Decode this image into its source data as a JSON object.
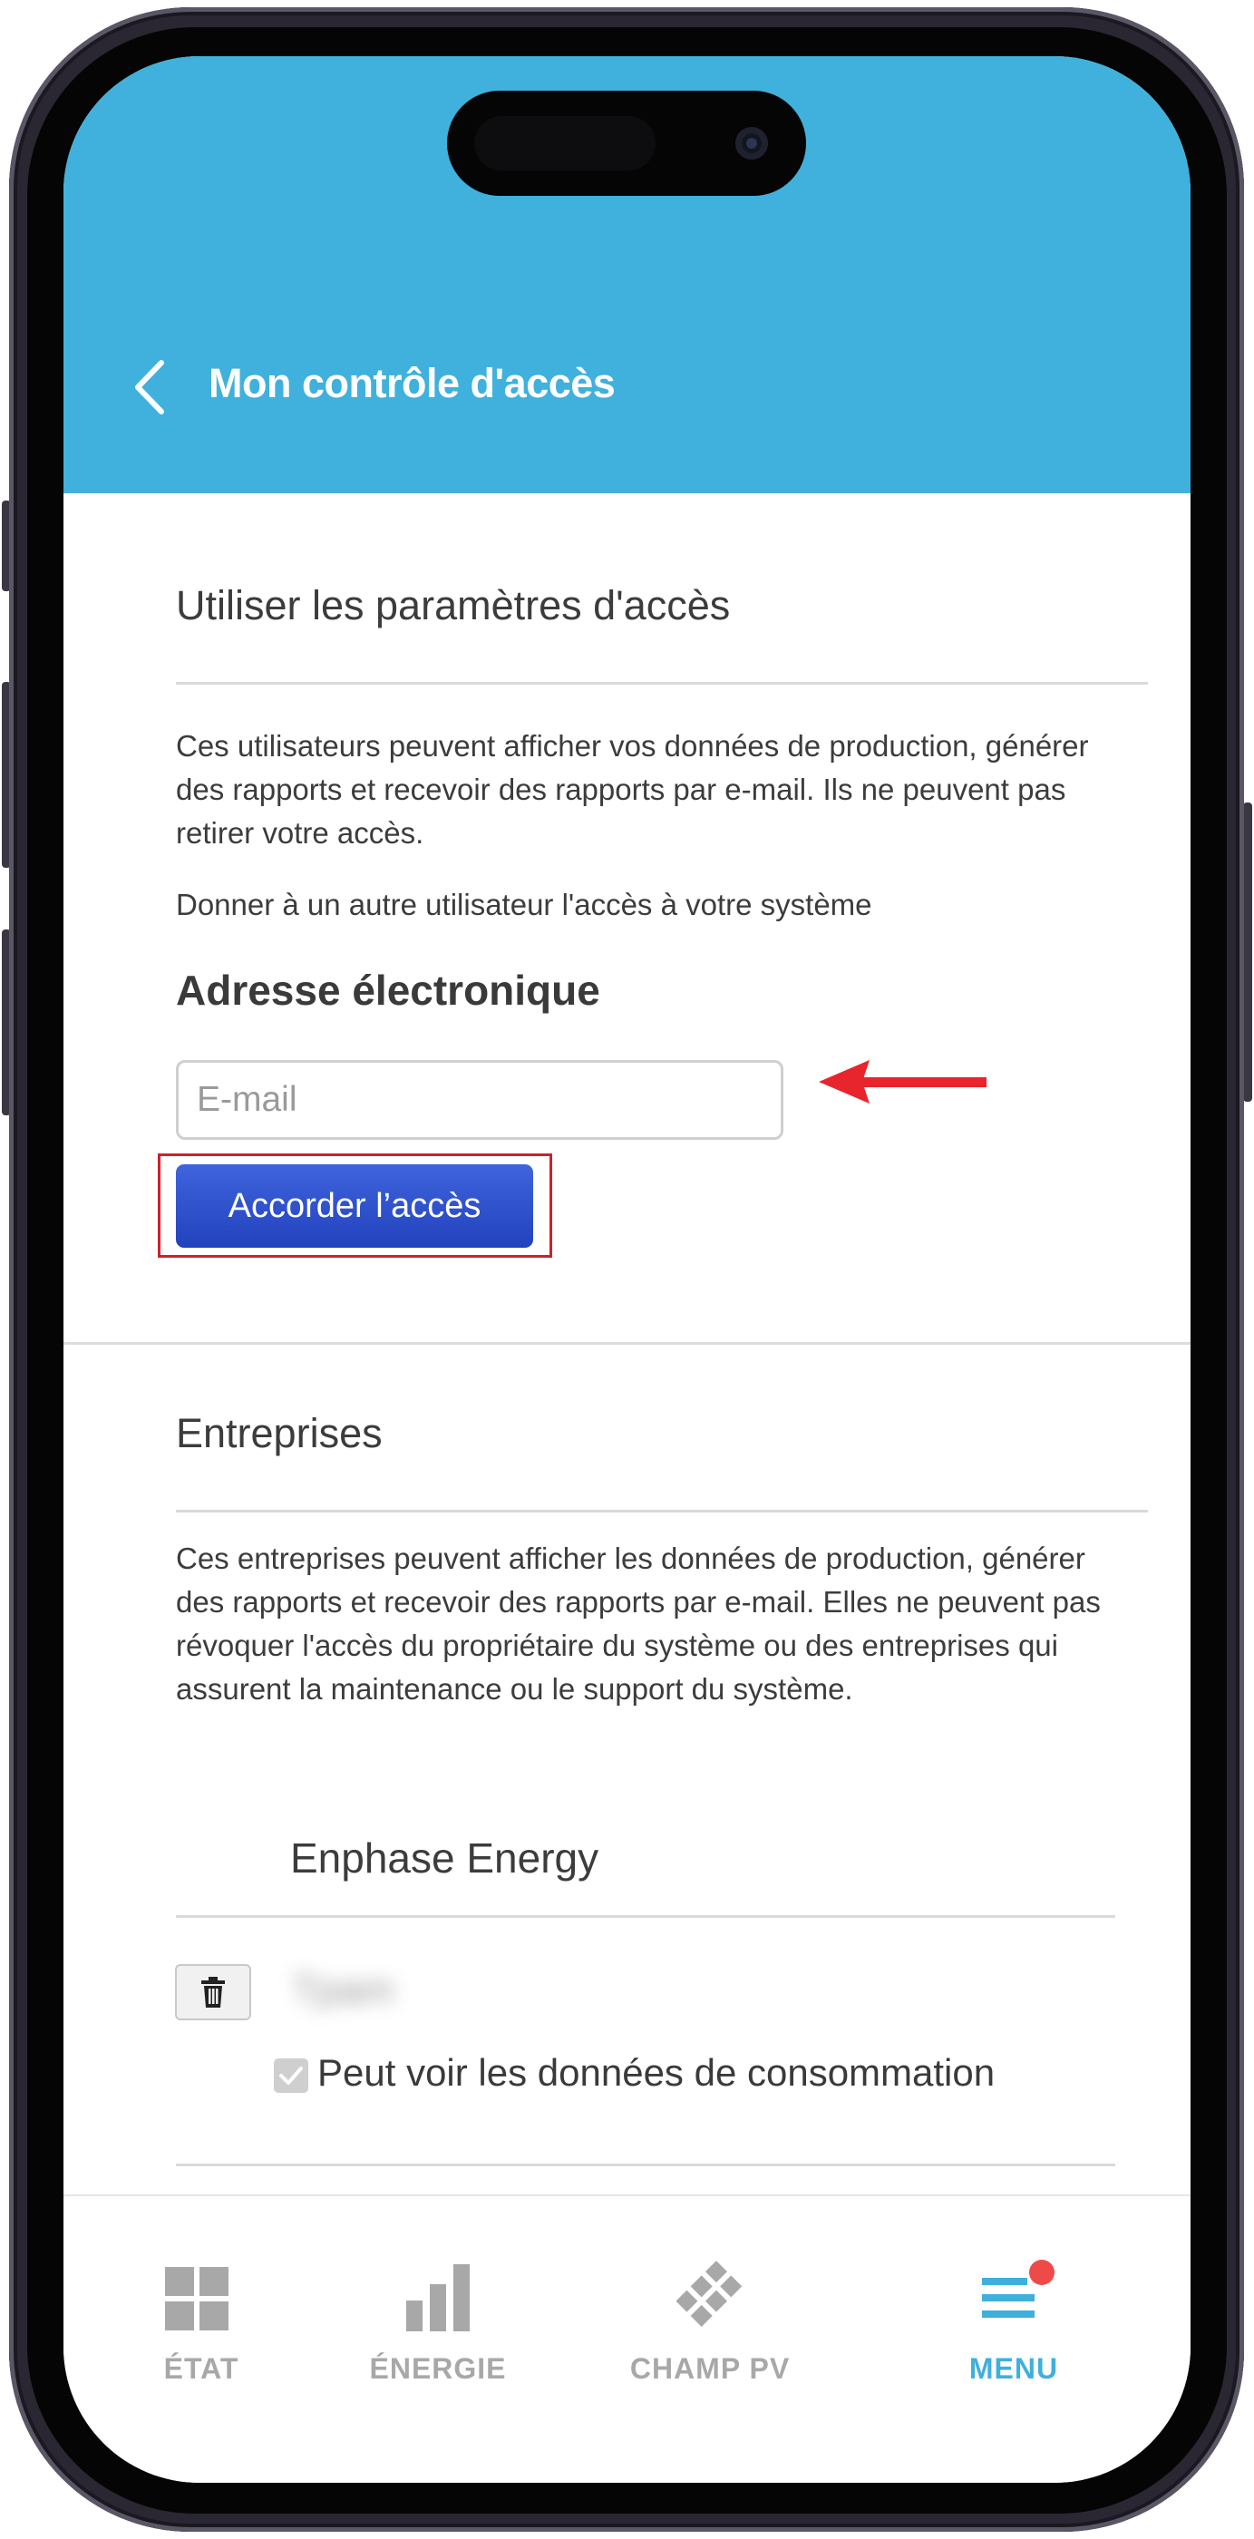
{
  "header": {
    "title": "Mon contrôle d'accès"
  },
  "user_access": {
    "section_title": "Utiliser les paramètres d'accès",
    "description": "Ces utilisateurs peuvent afficher vos données de production, générer des rapports et recevoir des rapports par e-mail. Ils ne peuvent pas retirer votre accès.",
    "give_access_text": "Donner à un autre utilisateur l'accès à votre système",
    "email_label": "Adresse électronique",
    "email_placeholder": "E-mail",
    "email_value": "",
    "grant_button_label": "Accorder l’accès"
  },
  "companies": {
    "section_title": "Entreprises",
    "description": "Ces entreprises peuvent afficher les données de production, générer des rapports et recevoir des rapports par e-mail. Elles ne peuvent pas révoquer l'accès du propriétaire du système ou des entreprises qui assurent la maintenance ou le support du système.",
    "company_name": "Enphase Energy",
    "member_name_blurred": "Tpam",
    "consumption_permission_label": "Peut voir les données de consommation",
    "consumption_permission_checked": true
  },
  "annotations": {
    "highlight_color": "#d0202a",
    "arrow_color": "#e8252d"
  },
  "tabbar": {
    "tabs": [
      {
        "label": "ÉTAT",
        "icon": "grid-icon",
        "active": false
      },
      {
        "label": "ÉNERGIE",
        "icon": "bar-chart-icon",
        "active": false
      },
      {
        "label": "CHAMP PV",
        "icon": "solar-panel-icon",
        "active": false
      },
      {
        "label": "MENU",
        "icon": "menu-icon",
        "active": true,
        "has_notification_dot": true
      }
    ]
  },
  "colors": {
    "header_bg": "#40b1dc",
    "button_bg": "#2f52cf",
    "active_tab": "#3fb0dc",
    "inactive_tab": "#a8a8a8",
    "notification_dot": "#ef4a4a"
  }
}
